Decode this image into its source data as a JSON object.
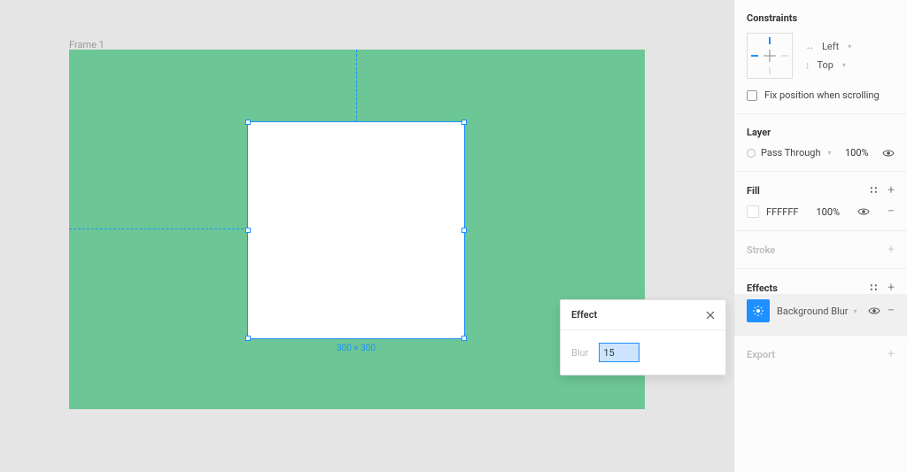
{
  "canvas": {
    "frame_label": "Frame 1",
    "dimensions": "300 × 300"
  },
  "popover": {
    "title": "Effect",
    "blur_label": "Blur",
    "blur_value": "15"
  },
  "inspector": {
    "constraints": {
      "title": "Constraints",
      "horizontal": "Left",
      "vertical": "Top",
      "fix_label": "Fix position when scrolling"
    },
    "layer": {
      "title": "Layer",
      "blend_mode": "Pass Through",
      "opacity": "100%"
    },
    "fill": {
      "title": "Fill",
      "hex": "FFFFFF",
      "opacity": "100%"
    },
    "stroke": {
      "title": "Stroke"
    },
    "effects": {
      "title": "Effects",
      "item": "Background Blur"
    },
    "export": {
      "title": "Export"
    }
  }
}
